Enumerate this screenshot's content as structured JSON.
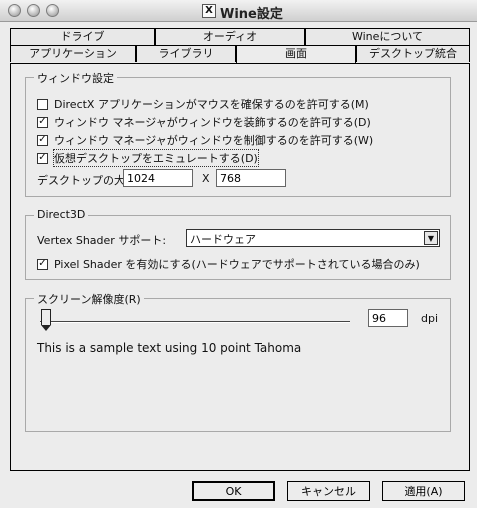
{
  "window": {
    "title": "Wine設定",
    "app_icon_glyph": "X"
  },
  "tabs": {
    "row1": [
      {
        "label": "ドライブ"
      },
      {
        "label": "オーディオ"
      },
      {
        "label": "Wineについて"
      }
    ],
    "row2": [
      {
        "label": "アプリケーション"
      },
      {
        "label": "ライブラリ"
      },
      {
        "label": "画面"
      },
      {
        "label": "デスクトップ統合"
      }
    ],
    "active": "画面"
  },
  "window_settings": {
    "title": "ウィンドウ設定",
    "options": [
      {
        "label": "DirectX アプリケーションがマウスを確保するのを許可する(M)",
        "checked": false
      },
      {
        "label": "ウィンドウ マネージャがウィンドウを装飾するのを許可する(D)",
        "checked": true
      },
      {
        "label": "ウィンドウ マネージャがウィンドウを制御するのを許可する(W)",
        "checked": true
      },
      {
        "label": "仮想デスクトップをエミュレートする(D)",
        "checked": true
      }
    ],
    "desktop_size_label": "デスクトップの大き",
    "width_value": "1024",
    "separator": "X",
    "height_value": "768"
  },
  "direct3d": {
    "title": "Direct3D",
    "vertex_shader_label": "Vertex Shader サポート:",
    "vertex_shader_value": "ハードウェア",
    "pixel_shader_label": "Pixel Shader を有効にする(ハードウェアでサポートされている場合のみ)",
    "pixel_shader_checked": true
  },
  "resolution": {
    "title": "スクリーン解像度(R)",
    "dpi_value": "96",
    "dpi_unit": "dpi",
    "sample_text": "This is a sample text using 10 point Tahoma"
  },
  "buttons": {
    "ok": "OK",
    "cancel": "キャンセル",
    "apply": "適用(A)"
  },
  "icons": {
    "check": "✓",
    "dropdown": "▼"
  }
}
